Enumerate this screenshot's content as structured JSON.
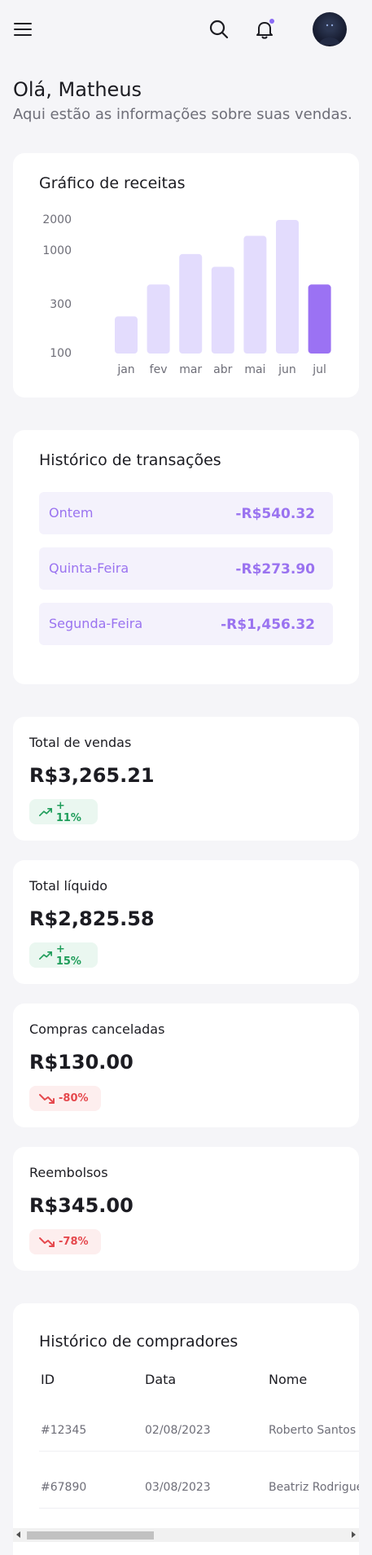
{
  "header": {
    "menu_icon": "hamburger-icon",
    "search_icon": "search-icon",
    "bell_icon": "bell-icon",
    "avatar_icon": "avatar"
  },
  "greeting": {
    "title": "Olá, Matheus",
    "subtitle": "Aqui estão as informações sobre suas vendas."
  },
  "revenue_chart": {
    "title": "Gráfico de receitas"
  },
  "chart_data": {
    "type": "bar",
    "title": "Gráfico de receitas",
    "categories": [
      "jan",
      "fev",
      "mar",
      "abr",
      "mai",
      "jun",
      "jul"
    ],
    "values": [
      230,
      470,
      930,
      700,
      1400,
      2000,
      470
    ],
    "ytick_labels": [
      "2000",
      "1000",
      "300",
      "100"
    ],
    "yticks": [
      2000,
      1000,
      300,
      100
    ],
    "ylim": [
      100,
      2000
    ],
    "yscale": "log",
    "grid": false,
    "highlight_index": 6,
    "colors": {
      "bar": "#e3dcfd",
      "highlight": "#9b72f3"
    }
  },
  "transactions": {
    "title": "Histórico de transações",
    "items": [
      {
        "day": "Ontem",
        "amount": "-R$540.32"
      },
      {
        "day": "Quinta-Feira",
        "amount": "-R$273.90"
      },
      {
        "day": "Segunda-Feira",
        "amount": "-R$1,456.32"
      }
    ]
  },
  "stats": [
    {
      "label": "Total de vendas",
      "value": "R$3,265.21",
      "change": "+ 11%",
      "trend": "up"
    },
    {
      "label": "Total líquido",
      "value": "R$2,825.58",
      "change": "+ 15%",
      "trend": "up"
    },
    {
      "label": "Compras canceladas",
      "value": "R$130.00",
      "change": "-80%",
      "trend": "down"
    },
    {
      "label": "Reembolsos",
      "value": "R$345.00",
      "change": "-78%",
      "trend": "down"
    }
  ],
  "buyers": {
    "title": "Histórico de compradores",
    "headers": [
      "ID",
      "Data",
      "Nome"
    ],
    "rows": [
      {
        "id": "#12345",
        "date": "02/08/2023",
        "name": "Roberto Santos"
      },
      {
        "id": "#67890",
        "date": "03/08/2023",
        "name": "Beatriz Rodrigues"
      }
    ]
  },
  "colors": {
    "accent": "#9b72f3",
    "positive": "#1f9d5a",
    "negative": "#e5484d"
  }
}
